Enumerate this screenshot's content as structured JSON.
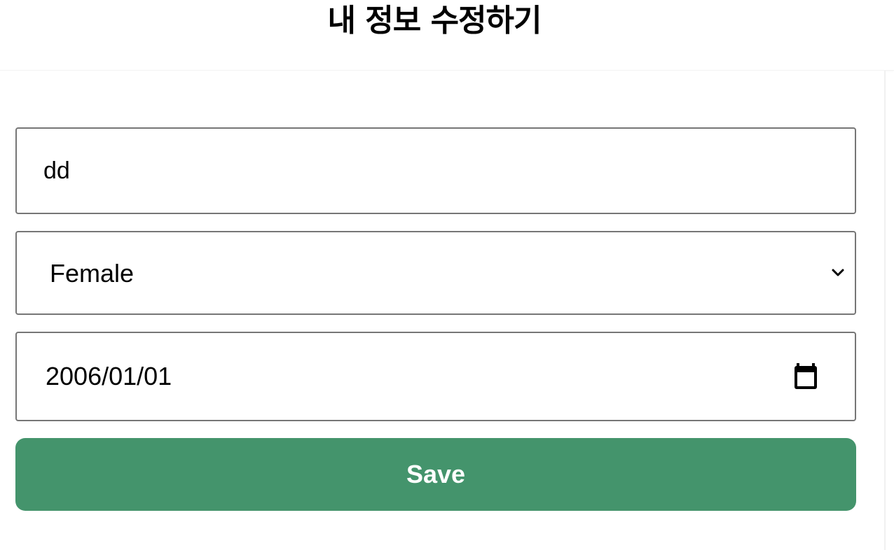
{
  "header": {
    "title": "내 정보 수정하기"
  },
  "form": {
    "name_value": "dd",
    "gender_value": "Female",
    "birthdate_value": "2006/01/01",
    "save_label": "Save"
  },
  "icons": {
    "select_arrow": "chevron-down-icon",
    "date_picker": "calendar-icon"
  },
  "colors": {
    "save_button_bg": "#44946c",
    "save_button_text": "#ffffff",
    "field_border": "#767676"
  }
}
